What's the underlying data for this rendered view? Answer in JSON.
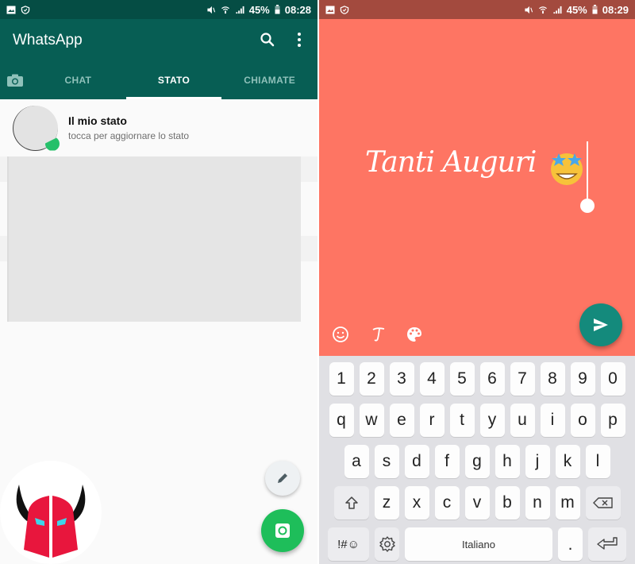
{
  "left_screen": {
    "status_bar": {
      "left_icons": [
        "gallery-icon",
        "shield-icon"
      ],
      "right_icons": [
        "mute-icon",
        "wifi-icon",
        "signal-icon"
      ],
      "battery": "45%",
      "time": "08:28"
    },
    "app_bar": {
      "title": "WhatsApp",
      "actions": [
        "search-icon",
        "more-vert-icon"
      ]
    },
    "tabs": [
      {
        "label": "",
        "icon": "camera-icon",
        "active": false
      },
      {
        "label": "CHAT",
        "active": false
      },
      {
        "label": "STATO",
        "active": true
      },
      {
        "label": "CHIAMATE",
        "active": false
      }
    ],
    "my_status": {
      "title": "Il mio stato",
      "subtitle": "tocca per aggiornare lo stato"
    },
    "fabs": [
      "pencil-icon",
      "camera-icon"
    ],
    "colors": {
      "primary": "#075e54",
      "status_bar": "#054d44",
      "accent": "#1ebe5a"
    }
  },
  "right_screen": {
    "status_bar": {
      "left_icons": [
        "gallery-icon",
        "shield-icon"
      ],
      "right_icons": [
        "mute-icon",
        "wifi-icon",
        "signal-icon"
      ],
      "battery": "45%",
      "time": "08:29"
    },
    "canvas": {
      "text": "Tanti Auguri",
      "emoji": "star-struck",
      "background": "#fe7563"
    },
    "tools": [
      "emoji-icon",
      "font-icon",
      "palette-icon"
    ],
    "send_button": "send-icon",
    "keyboard": {
      "row_numbers": [
        "1",
        "2",
        "3",
        "4",
        "5",
        "6",
        "7",
        "8",
        "9",
        "0"
      ],
      "row_1": [
        "q",
        "w",
        "e",
        "r",
        "t",
        "y",
        "u",
        "i",
        "o",
        "p"
      ],
      "row_2": [
        "a",
        "s",
        "d",
        "f",
        "g",
        "h",
        "j",
        "k",
        "l"
      ],
      "row_3": [
        "z",
        "x",
        "c",
        "v",
        "b",
        "n",
        "m"
      ],
      "symbols_label": "!#☺",
      "space_label": "Italiano",
      "period_label": "."
    }
  }
}
